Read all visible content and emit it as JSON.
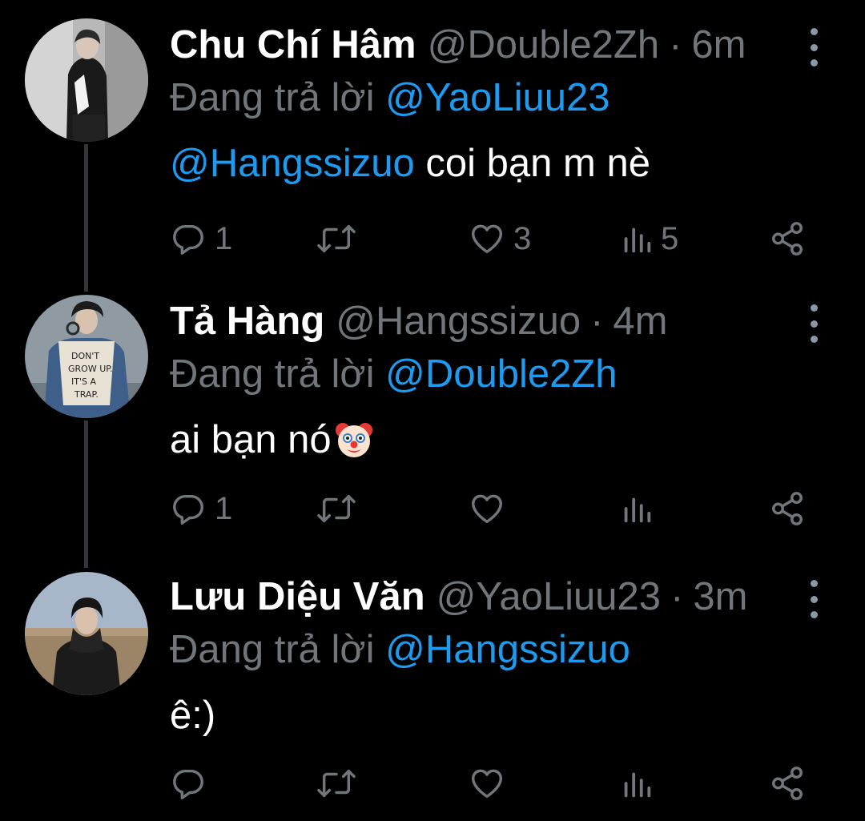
{
  "theme": {
    "background": "#000000",
    "text": "#ffffff",
    "muted": "#71767b",
    "accent": "#1d9bf0",
    "thread_line": "#333639"
  },
  "tweets": [
    {
      "name": "Chu Chí Hâm",
      "handle": "@Double2Zh",
      "separator": "·",
      "time": "6m",
      "replying_prefix": "Đang trả lời",
      "replying_to": "@YaoLiuu23",
      "text_mention": "@Hangssizuo",
      "text": " coi bạn m nè",
      "reply_count": "1",
      "retweet_count": "",
      "like_count": "3",
      "view_count": "5",
      "avatar_icon": "avatar-photo"
    },
    {
      "name": "Tả Hàng",
      "handle": "@Hangssizuo",
      "separator": "·",
      "time": "4m",
      "replying_prefix": "Đang trả lời",
      "replying_to": "@Double2Zh",
      "text_mention": "",
      "text": "ai bạn nó",
      "emoji_icon": "clown-face-emoji",
      "avatar_text": "DON'T GROW UP. IT'S A TRAP.",
      "reply_count": "1",
      "retweet_count": "",
      "like_count": "",
      "view_count": ""
    },
    {
      "name": "Lưu Diệu Văn",
      "handle": "@YaoLiuu23",
      "separator": "·",
      "time": "3m",
      "replying_prefix": "Đang trả lời",
      "replying_to": "@Hangssizuo",
      "text_mention": "",
      "text": "ê:)",
      "reply_count": "",
      "retweet_count": "",
      "like_count": "",
      "view_count": ""
    }
  ]
}
